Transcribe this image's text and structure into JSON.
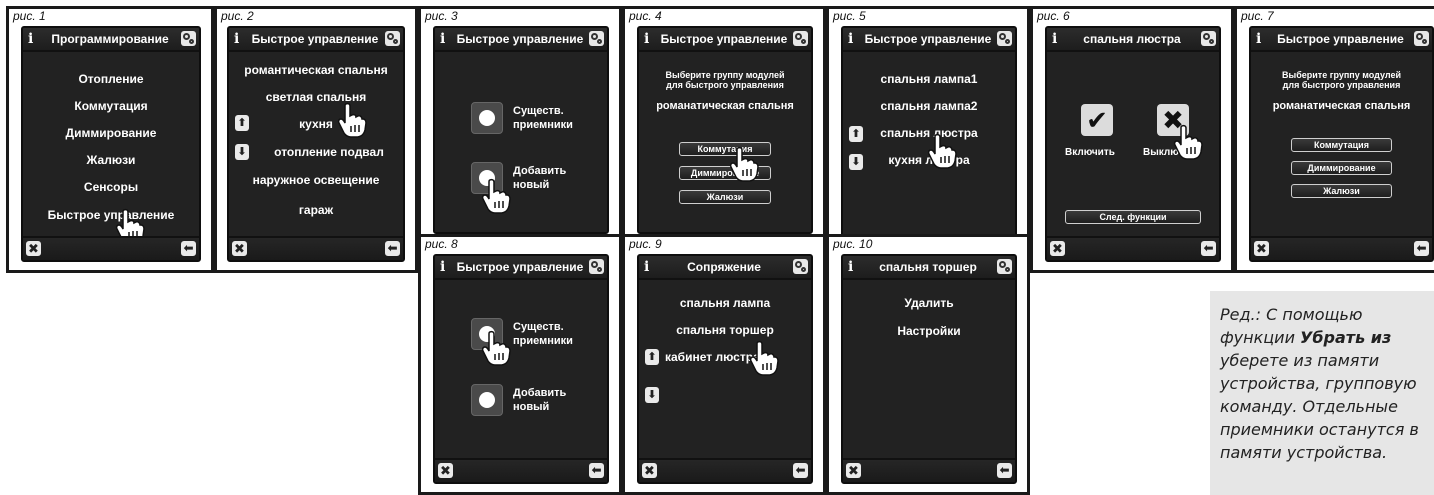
{
  "captions": [
    "рис. 1",
    "рис. 2",
    "рис. 3",
    "рис. 4",
    "рис. 5",
    "рис. 6",
    "рис. 7",
    "рис. 8",
    "рис. 9",
    "рис. 10"
  ],
  "info_glyph": "i",
  "close_glyph": "✖",
  "back_glyph": "⬅",
  "up_glyph": "⬆",
  "down_glyph": "⬇",
  "fig1": {
    "title": "Программирование",
    "items": [
      "Отопление",
      "Коммутация",
      "Диммирование",
      "Жалюзи",
      "Сенсоры",
      "Быстрое управление"
    ]
  },
  "fig2": {
    "title": "Быстрое управление",
    "items": [
      "романтическая спальня",
      "светлая спальня",
      "кухня",
      "отопление подвал",
      "наружное освещение",
      "гараж"
    ]
  },
  "fig3": {
    "title": "Быстрое управление",
    "btn1": [
      "Существ.",
      "приемники"
    ],
    "btn2": [
      "Добавить",
      "новый"
    ]
  },
  "fig4": {
    "title": "Быстрое управление",
    "prompt": [
      "Выберите группу модулей",
      "для быстрого управления"
    ],
    "group": "романатическая спальня",
    "options": [
      "Коммутация",
      "Диммирование",
      "Жалюзи"
    ]
  },
  "fig5": {
    "title": "Быстрое управление",
    "items": [
      "спальня лампа1",
      "спальня лампа2",
      "спальня люстра",
      "кухня люстра"
    ]
  },
  "fig6": {
    "title": "спальня люстра",
    "on": "Включить",
    "off": "Выключить",
    "next": "След. функции",
    "on_glyph": "✔",
    "off_glyph": "✖"
  },
  "fig7": {
    "title": "Быстрое управление",
    "prompt": [
      "Выберите группу модулей",
      "для быстрого управления"
    ],
    "group": "романатическая спальня",
    "options": [
      "Коммутация",
      "Диммирование",
      "Жалюзи"
    ]
  },
  "fig8": {
    "title": "Быстрое управление",
    "btn1": [
      "Существ.",
      "приемники"
    ],
    "btn2": [
      "Добавить",
      "новый"
    ]
  },
  "fig9": {
    "title": "Сопряжение",
    "items": [
      "спальня лампа",
      "спальня торшер",
      "кабинет люстра"
    ]
  },
  "fig10": {
    "title": "спальня торшер",
    "items": [
      "Удалить",
      "Настройки"
    ]
  },
  "note": {
    "prefix": "Ред.: С помощью функции ",
    "bold": "Убрать из",
    "rest": " уберете из памяти устройства, групповую команду. Отдельные приемники останутся в памяти устройства."
  }
}
